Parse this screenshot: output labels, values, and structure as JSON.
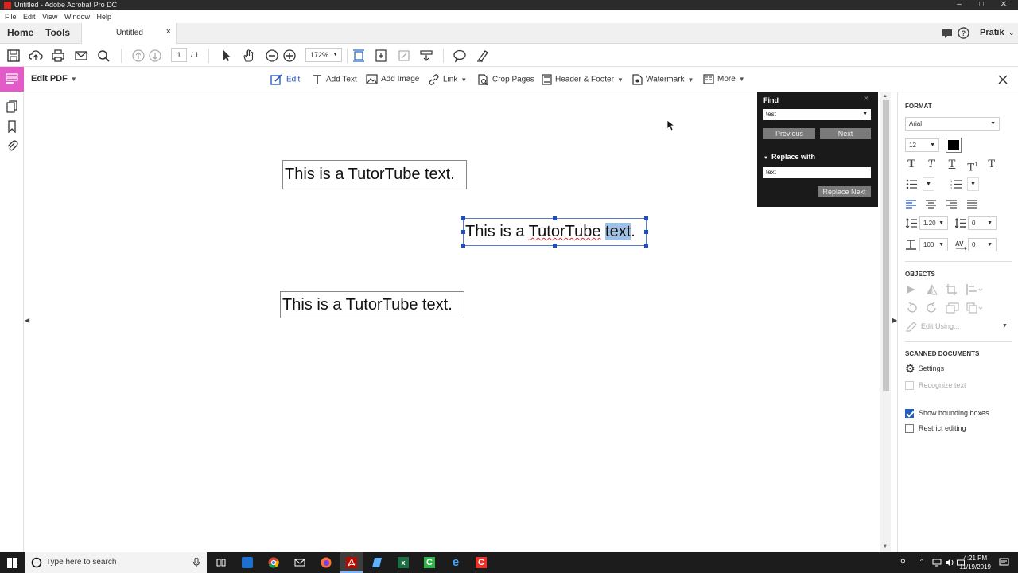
{
  "window": {
    "title": "Untitled - Adobe Acrobat Pro DC"
  },
  "menu": [
    "File",
    "Edit",
    "View",
    "Window",
    "Help"
  ],
  "nav": {
    "home": "Home",
    "tools": "Tools",
    "doc_tab": "Untitled",
    "close": "×",
    "user": "Pratik"
  },
  "toolbar": {
    "page_current": "1",
    "page_total": "/ 1",
    "zoom": "172%"
  },
  "editbar": {
    "title": "Edit PDF",
    "tools": [
      "Edit",
      "Add Text",
      "Add Image",
      "Link",
      "Crop Pages",
      "Header & Footer",
      "Watermark",
      "More"
    ]
  },
  "document": {
    "box1": "This is a TutorTube text.",
    "box2_prefix": "This is a ",
    "box2_squiggle": "TutorTube",
    "box2_mid": " ",
    "box2_highlight": "text",
    "box2_suffix": ".",
    "box3": "This is a TutorTube text."
  },
  "find": {
    "title": "Find",
    "query": "test",
    "previous": "Previous",
    "next": "Next",
    "replace_label": "Replace with",
    "replace_value": "text",
    "replace_next": "Replace Next"
  },
  "format": {
    "header": "FORMAT",
    "font": "Arial",
    "size": "12",
    "line_spacing": "1.20",
    "para_spacing": "0",
    "scale": "100",
    "char_spacing": "0",
    "color": "#000000"
  },
  "objects": {
    "header": "OBJECTS",
    "edit_using": "Edit Using..."
  },
  "scanned": {
    "header": "SCANNED DOCUMENTS",
    "settings": "Settings",
    "recognize": "Recognize text",
    "show_boxes": "Show bounding boxes",
    "show_boxes_checked": true,
    "restrict": "Restrict editing",
    "restrict_checked": false
  },
  "taskbar": {
    "search_placeholder": "Type here to search",
    "time": "4:21 PM",
    "date": "11/19/2019"
  },
  "colors": {
    "accent_pink": "#e35ac9",
    "select_blue": "#1f4fbf",
    "highlight": "#9ec1e6",
    "find_bg": "#1a1a1a"
  }
}
